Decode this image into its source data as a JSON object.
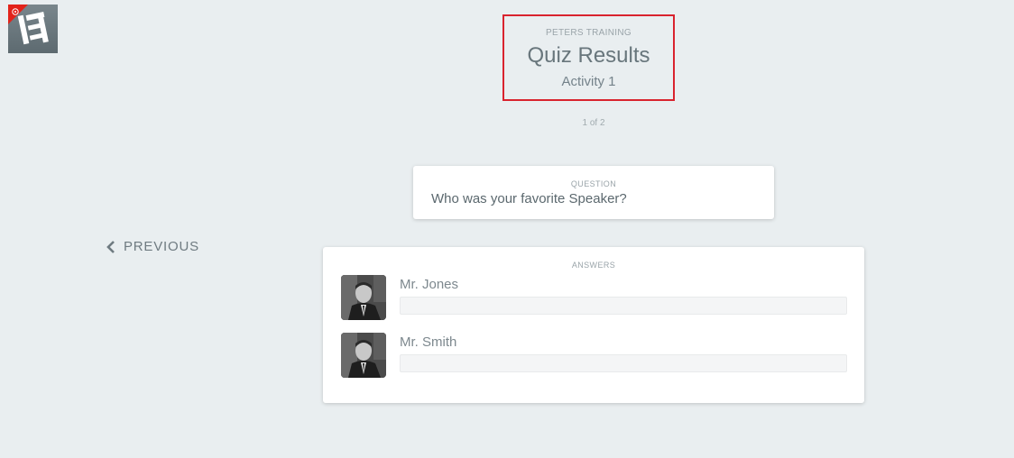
{
  "header": {
    "org_name": "PETERS TRAINING",
    "title": "Quiz Results",
    "activity": "Activity 1"
  },
  "pager": {
    "text": "1 of 2"
  },
  "question": {
    "label": "QUESTION",
    "text": "Who was your favorite Speaker?"
  },
  "nav": {
    "previous_label": "PREVIOUS"
  },
  "answers": {
    "label": "ANSWERS",
    "items": [
      {
        "name": "Mr. Jones",
        "share": 0
      },
      {
        "name": "Mr. Smith",
        "share": 0
      }
    ]
  },
  "colors": {
    "background": "#e9eef0",
    "highlight_border": "#d9232e",
    "logo_badge": "#e2231a"
  }
}
